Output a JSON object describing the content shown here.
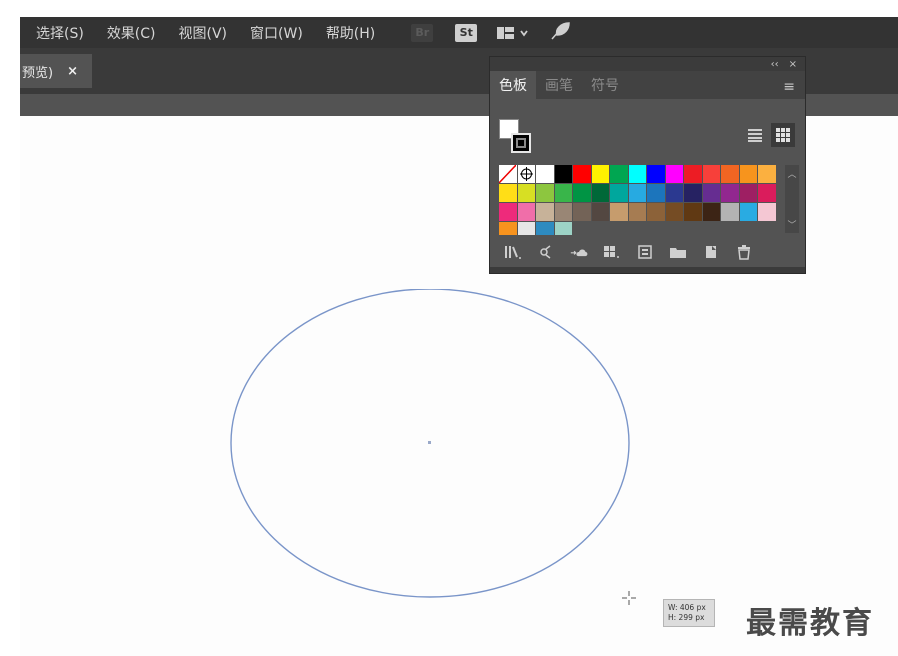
{
  "menubar": {
    "items": [
      "选择(S)",
      "效果(C)",
      "视图(V)",
      "窗口(W)",
      "帮助(H)"
    ],
    "app_icons": {
      "bridge": "Br",
      "stock": "St"
    },
    "icons": [
      "layout-grid-icon",
      "chevron-down-icon",
      "feather-icon"
    ]
  },
  "document_tab": {
    "label": "预览)",
    "close": "×"
  },
  "swatches_panel": {
    "top_controls": {
      "collapse": "‹‹",
      "close": "×"
    },
    "tabs": [
      "色板",
      "画笔",
      "符号"
    ],
    "active_tab": "色板",
    "menu_icon": "≡",
    "colors": [
      "none",
      "registration",
      "#ffffff",
      "#000000",
      "#ff0000",
      "#fff200",
      "#00a651",
      "#00ffff",
      "#0000ff",
      "#ff00ff",
      "#ed1c24",
      "#f7403a",
      "#f26522",
      "#f7941d",
      "#fbb040",
      "#ffde17",
      "#d7df23",
      "#8dc63f",
      "#39b54a",
      "#009444",
      "#006838",
      "#00a79d",
      "#27aae1",
      "#1c75bc",
      "#2b3990",
      "#262262",
      "#662d91",
      "#92278f",
      "#9e1f63",
      "#da1c5c",
      "#ee2a7b",
      "#f06ea9",
      "#c7b299",
      "#998675",
      "#736357",
      "#534741",
      "#c69c6d",
      "#a67c52",
      "#8c6239",
      "#754c24",
      "#603913",
      "#3c2415",
      "#b3b3b3",
      "#29abe2",
      "#f4c7d3",
      "#f7931e",
      "#e6e6e6",
      "#2e8bc0",
      "#9dd3c6"
    ],
    "footer_icons": [
      "library-icon",
      "show-kinds-icon",
      "cloud-add-icon",
      "swatch-options-icon",
      "new-color-group-icon",
      "folder-icon",
      "new-swatch-icon",
      "delete-icon"
    ]
  },
  "tooltip": {
    "width": "W: 406 px",
    "height": "H: 299 px"
  },
  "watermark": "最需教育",
  "colors": {
    "menubar": "#333333",
    "panel": "#535353",
    "ellipse_stroke": "#7a95c9",
    "canvas": "#fdfdfd"
  }
}
